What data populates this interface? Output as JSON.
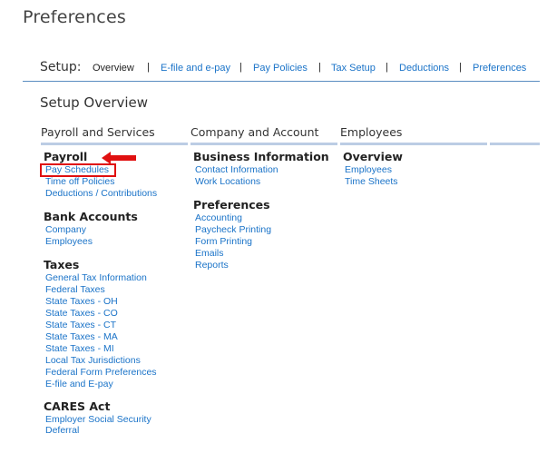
{
  "page": {
    "title": "Preferences"
  },
  "setup": {
    "label": "Setup:",
    "separator": "|",
    "links": [
      "Overview",
      "E-file and e-pay",
      "Pay Policies",
      "Tax Setup",
      "Deductions",
      "Preferences"
    ]
  },
  "overview": {
    "heading": "Setup Overview"
  },
  "columns": {
    "payroll": {
      "header": "Payroll and Services",
      "groups": [
        {
          "title": "Payroll",
          "items": [
            "Pay Schedules",
            "Time off Policies",
            "Deductions / Contributions"
          ]
        },
        {
          "title": "Bank Accounts",
          "items": [
            "Company",
            "Employees"
          ]
        },
        {
          "title": "Taxes",
          "items": [
            "General Tax Information",
            "Federal Taxes",
            "State Taxes - OH",
            "State Taxes - CO",
            "State Taxes - CT",
            "State Taxes - MA",
            "State Taxes - MI",
            "Local Tax Jurisdictions",
            "Federal Form Preferences",
            "E-file and E-pay"
          ]
        },
        {
          "title": "CARES Act",
          "items": [
            "Employer Social Security",
            "Deferral"
          ]
        }
      ]
    },
    "company": {
      "header": "Company and Account",
      "groups": [
        {
          "title": "Business Information",
          "items": [
            "Contact Information",
            "Work Locations"
          ]
        },
        {
          "title": "Preferences",
          "items": [
            "Accounting",
            "Paycheck Printing",
            "Form Printing",
            "Emails",
            "Reports"
          ]
        }
      ]
    },
    "employees": {
      "header": "Employees",
      "groups": [
        {
          "title": "Overview",
          "items": [
            "Employees",
            "Time Sheets"
          ]
        }
      ]
    }
  },
  "annotation": {
    "color": "#e01010",
    "target": "Pay Schedules"
  }
}
